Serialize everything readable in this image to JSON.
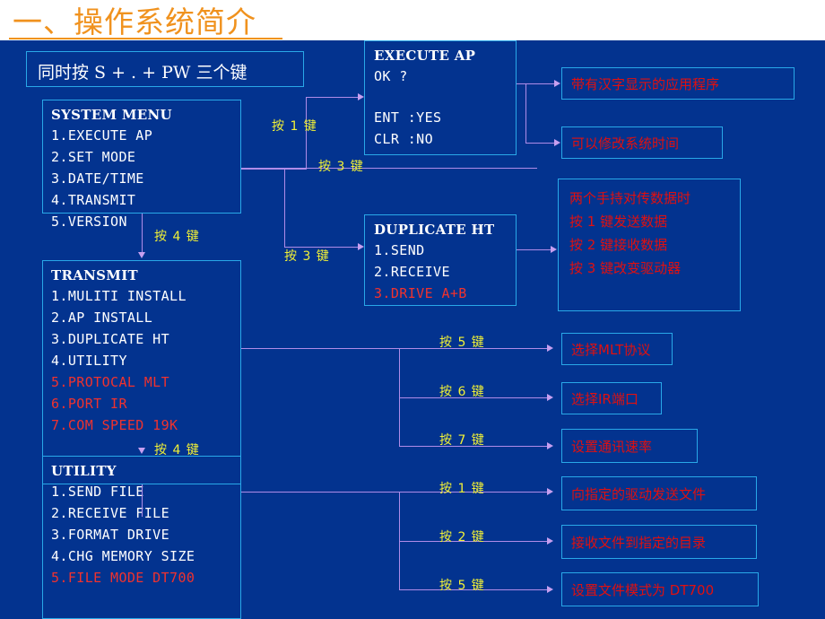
{
  "slide": {
    "title": "一、操作系统简介",
    "accent_orange": "#f0921e",
    "background_blue": "#03338f",
    "box_border_cyan": "#29a8e8",
    "red_text": "#e01010",
    "yellow_label": "#f2f23a",
    "connector_purple": "#b08ce8"
  },
  "intro": {
    "text": "同时按  S + . + PW 三个键"
  },
  "menus": {
    "system_menu": {
      "title": "SYSTEM MENU",
      "items": [
        {
          "text": "1.EXECUTE AP",
          "red": false
        },
        {
          "text": "2.SET MODE",
          "red": false
        },
        {
          "text": "3.DATE/TIME",
          "red": false
        },
        {
          "text": "4.TRANSMIT",
          "red": false
        },
        {
          "text": "5.VERSION",
          "red": false
        }
      ]
    },
    "execute_ap": {
      "title": "EXECUTE  AP",
      "items": [
        {
          "text": "OK ?",
          "red": false
        },
        {
          "text": "",
          "red": false
        },
        {
          "text": "ENT :YES",
          "red": false
        },
        {
          "text": "CLR :NO",
          "red": false
        }
      ]
    },
    "duplicate_ht": {
      "title": "DUPLICATE HT",
      "items": [
        {
          "text": "1.SEND",
          "red": false
        },
        {
          "text": "2.RECEIVE",
          "red": false
        },
        {
          "text": "3.DRIVE     A+B",
          "red": true
        }
      ]
    },
    "transmit": {
      "title": "TRANSMIT",
      "items": [
        {
          "text": "1.MULITI INSTALL",
          "red": false
        },
        {
          "text": "2.AP INSTALL",
          "red": false
        },
        {
          "text": "3.DUPLICATE HT",
          "red": false
        },
        {
          "text": "4.UTILITY",
          "red": false
        },
        {
          "text": "5.PROTOCAL  MLT",
          "red": true
        },
        {
          "text": "6.PORT        IR",
          "red": true
        },
        {
          "text": "7.COM SPEED 19K",
          "red": true
        }
      ]
    },
    "utility": {
      "title": "UTILITY",
      "items": [
        {
          "text": "1.SEND FILE",
          "red": false
        },
        {
          "text": "2.RECEIVE FILE",
          "red": false
        },
        {
          "text": "3.FORMAT DRIVE",
          "red": false
        },
        {
          "text": "4.CHG MEMORY SIZE",
          "red": false
        },
        {
          "text": "5.FILE MODE DT700",
          "red": true
        }
      ]
    }
  },
  "annotations": {
    "chinese_app": "带有汉字显示的应用程序",
    "chinese_time": "可以修改系统时间",
    "duplicate_note": [
      "两个手持对传数据时",
      "按 1 键发送数据",
      "按 2 键接收数据",
      "按 3 键改变驱动器"
    ],
    "mlt_protocol": "选择MLT协议",
    "ir_port": "选择IR端口",
    "com_speed": "设置通讯速率",
    "send_file": "向指定的驱动发送文件",
    "receive_file": "接收文件到指定的目录",
    "file_mode": "设置文件模式为 DT700"
  },
  "key_labels": {
    "k1_execute": "按 1 键",
    "k3_duplicate_top": "按 3 键",
    "k4_transmit": "按 4 键",
    "k3_duplicate_mid": "按 3 键",
    "k4_utility": "按 4 键",
    "k5_protocol": "按 5 键",
    "k6_port": "按 6 键",
    "k7_speed": "按 7 键",
    "k1_send": "按 1 键",
    "k2_receive": "按 2 键",
    "k5_filemode": "按 5 键"
  }
}
